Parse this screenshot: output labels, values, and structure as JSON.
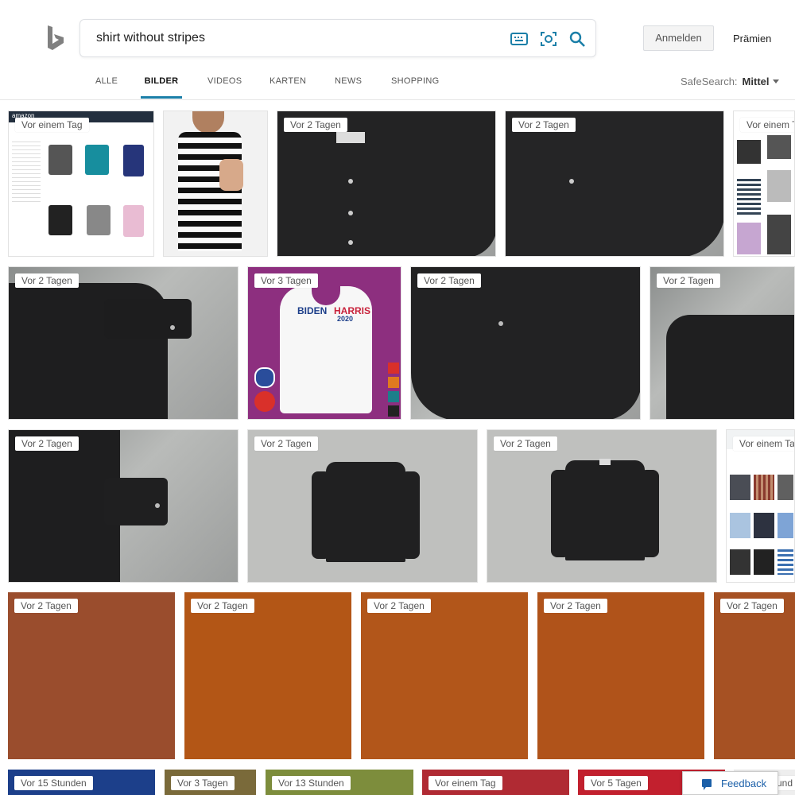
{
  "search": {
    "query": "shirt without stripes"
  },
  "header": {
    "signin_label": "Anmelden",
    "rewards_label": "Prämien",
    "safesearch_label": "SafeSearch:",
    "safesearch_value": "Mittel"
  },
  "tabs": [
    "ALLE",
    "BILDER",
    "VIDEOS",
    "KARTEN",
    "NEWS",
    "SHOPPING"
  ],
  "active_tab": "BILDER",
  "results": [
    {
      "badge": "Vor einem Tag"
    },
    {
      "badge": ""
    },
    {
      "badge": "Vor 2 Tagen"
    },
    {
      "badge": "Vor 2 Tagen"
    },
    {
      "badge": "Vor einem T"
    },
    {
      "badge": "Vor 2 Tagen"
    },
    {
      "badge": "Vor 3 Tagen"
    },
    {
      "badge": "Vor 2 Tagen"
    },
    {
      "badge": "Vor 2 Tagen"
    },
    {
      "badge": "Vor 2 Tagen"
    },
    {
      "badge": "Vor 2 Tagen"
    },
    {
      "badge": "Vor 2 Tagen"
    },
    {
      "badge": "Vor einem Ta"
    },
    {
      "badge": "Vor 2 Tagen"
    },
    {
      "badge": "Vor 2 Tagen"
    },
    {
      "badge": "Vor 2 Tagen"
    },
    {
      "badge": "Vor 2 Tagen"
    },
    {
      "badge": "Vor 2 Tagen"
    },
    {
      "badge": "Vor 15 Stunden"
    },
    {
      "badge": "Vor 3 Tagen"
    },
    {
      "badge": "Vor 13 Stunden"
    },
    {
      "badge": "Vor einem Tag"
    },
    {
      "badge": "Vor 5 Tagen"
    },
    {
      "badge": "cund"
    }
  ],
  "thumb_texts": {
    "biden": "BIDEN",
    "harris": "HARRIS",
    "year": "2020",
    "amazon": "amazon"
  },
  "feedback_label": "Feedback",
  "colors": {
    "accent": "#1b7fa8",
    "bing_logo": "#808080"
  }
}
